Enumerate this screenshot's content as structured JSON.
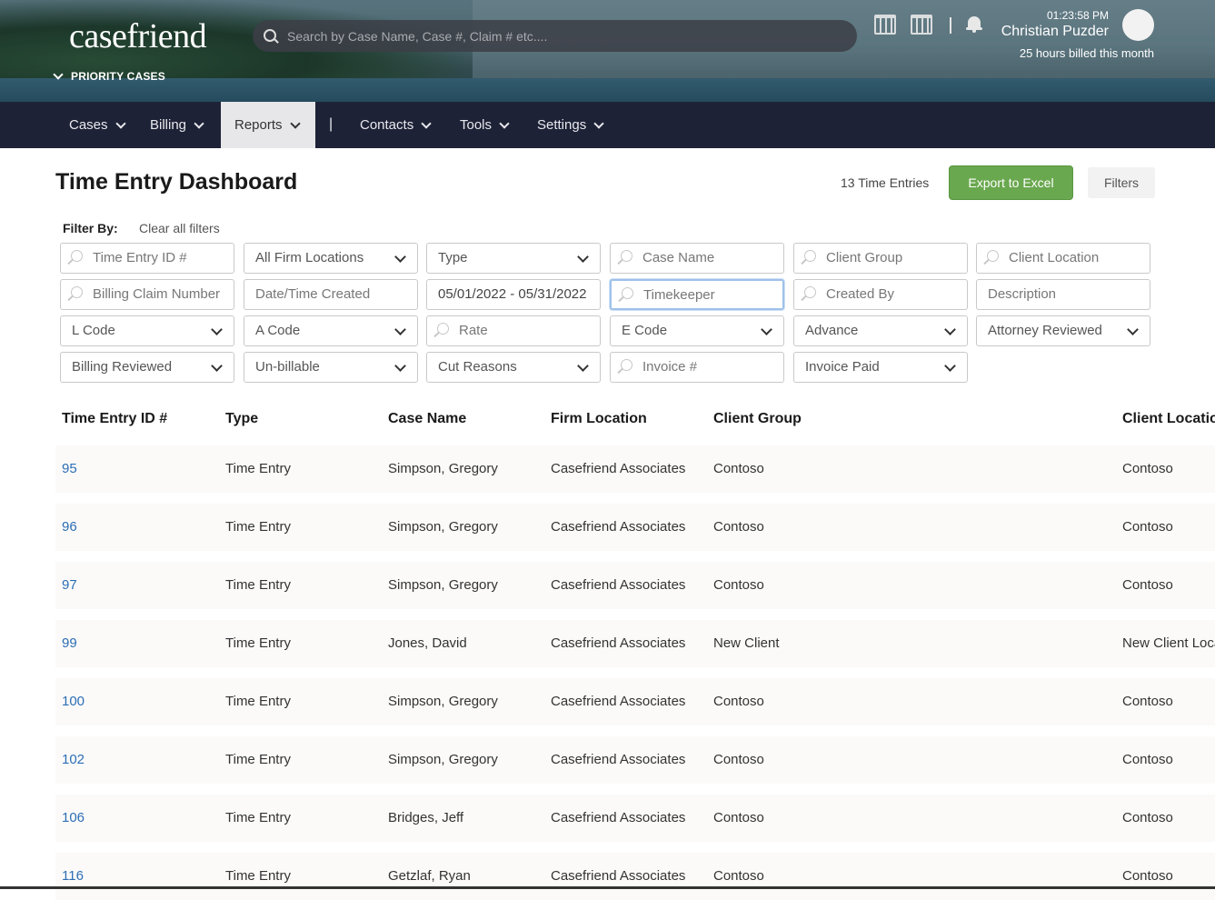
{
  "header": {
    "logo": "casefriend",
    "priority_label": "PRIORITY CASES",
    "search_placeholder": "Search by Case Name, Case #, Claim # etc....",
    "time": "01:23:58 PM",
    "user_name": "Christian Puzder",
    "billed": "25 hours billed this month"
  },
  "nav": {
    "items": [
      "Cases",
      "Billing",
      "Reports",
      "Contacts",
      "Tools",
      "Settings"
    ],
    "separator": "|",
    "active": "Reports"
  },
  "page": {
    "title": "Time Entry Dashboard",
    "count": "13 Time Entries",
    "export_label": "Export to Excel",
    "filters_label": "Filters",
    "filter_by": "Filter By:",
    "clear_all": "Clear all filters"
  },
  "filters": [
    "Time Entry ID #",
    "All Firm Locations",
    "Type",
    "Case Name",
    "Client Group",
    "Client Location",
    "Billing Claim Number",
    "Date/Time Created",
    "05/01/2022 - 05/31/2022",
    "Timekeeper",
    "Created By",
    "Description",
    "L Code",
    "A Code",
    "Rate",
    "E Code",
    "Advance",
    "Attorney Reviewed",
    "Billing Reviewed",
    "Un-billable",
    "Cut Reasons",
    "Invoice #",
    "Invoice Paid"
  ],
  "table": {
    "columns": [
      "Time Entry ID #",
      "Type",
      "Case Name",
      "Firm Location",
      "Client Group",
      "Client Location"
    ],
    "rows": [
      [
        "95",
        "Time Entry",
        "Simpson, Gregory",
        "Casefriend Associates",
        "Contoso",
        "Contoso"
      ],
      [
        "96",
        "Time Entry",
        "Simpson, Gregory",
        "Casefriend Associates",
        "Contoso",
        "Contoso"
      ],
      [
        "97",
        "Time Entry",
        "Simpson, Gregory",
        "Casefriend Associates",
        "Contoso",
        "Contoso"
      ],
      [
        "99",
        "Time Entry",
        "Jones, David",
        "Casefriend Associates",
        "New Client",
        "New Client Location"
      ],
      [
        "100",
        "Time Entry",
        "Simpson, Gregory",
        "Casefriend Associates",
        "Contoso",
        "Contoso"
      ],
      [
        "102",
        "Time Entry",
        "Simpson, Gregory",
        "Casefriend Associates",
        "Contoso",
        "Contoso"
      ],
      [
        "106",
        "Time Entry",
        "Bridges, Jeff",
        "Casefriend Associates",
        "Contoso",
        "Contoso"
      ],
      [
        "116",
        "Time Entry",
        "Getzlaf, Ryan",
        "Casefriend Associates",
        "Contoso",
        "Contoso"
      ]
    ]
  },
  "colors": {
    "nav_bg": "#1e2236",
    "export_green": "#6aa84f",
    "link_blue": "#2c6eb5"
  },
  "icons": [
    "search-icon",
    "calendar-icon",
    "calendar-alt-icon",
    "bell-icon",
    "chevron-down-icon",
    "avatar"
  ]
}
